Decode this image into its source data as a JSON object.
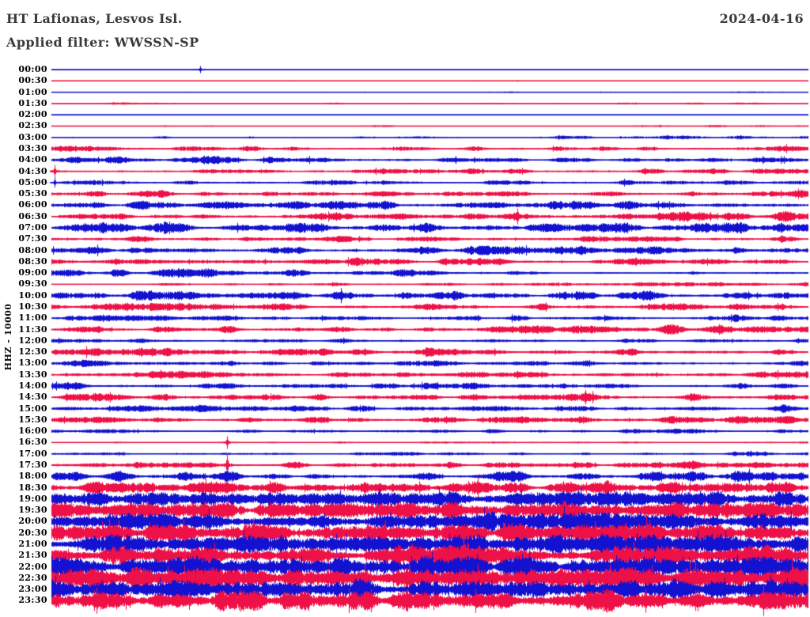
{
  "header": {
    "station": "HT Lafionas, Lesvos Isl.",
    "filter": "Applied filter: WWSSN-SP",
    "date": "2024-04-16"
  },
  "chart_data": {
    "type": "line",
    "subtype": "helicorder_day_plot",
    "title": "HT Lafionas, Lesvos Isl.",
    "date": "2024-04-16",
    "applied_filter": "WWSSN-SP",
    "y_axis_label": "HHZ - 10000",
    "channel": "HHZ",
    "scale": 10000,
    "row_interval_minutes": 30,
    "n_rows": 48,
    "grid": false,
    "legend_position": "none",
    "colors": {
      "blue": "#1212d0",
      "red": "#ee1147"
    },
    "rows": [
      {
        "time": "00:00",
        "color": "blue",
        "env": [
          0.5,
          0.5,
          0.5,
          0.6,
          0.5,
          0.6,
          0.5,
          0.5,
          0.6,
          0.5,
          0.5,
          0.5
        ],
        "spikes": [
          [
            0.196,
            4.5
          ]
        ]
      },
      {
        "time": "00:30",
        "color": "red",
        "env": [
          0.5,
          0.5,
          0.5,
          0.5,
          0.5,
          0.6,
          0.5,
          0.5,
          0.5,
          0.6,
          0.5,
          0.5
        ]
      },
      {
        "time": "01:00",
        "color": "blue",
        "env": [
          0.5,
          0.5,
          0.5,
          0.5,
          0.5,
          0.5,
          0.7,
          0.9,
          0.6,
          0.5,
          0.9,
          0.6
        ]
      },
      {
        "time": "01:30",
        "color": "red",
        "env": [
          0.6,
          1.3,
          0.7,
          0.6,
          1.1,
          0.7,
          1.3,
          1.1,
          1.3,
          0.9,
          1.5,
          1.1
        ]
      },
      {
        "time": "02:00",
        "color": "blue",
        "env": [
          0.5,
          0.5,
          0.5,
          0.5,
          0.5,
          0.5,
          0.5,
          0.5,
          0.8,
          0.5,
          0.5,
          0.5
        ]
      },
      {
        "time": "02:30",
        "color": "red",
        "env": [
          0.6,
          0.8,
          1.1,
          0.6,
          0.6,
          1.2,
          0.7,
          1.3,
          0.8,
          1.4,
          1.1,
          1.3
        ]
      },
      {
        "time": "03:00",
        "color": "blue",
        "env": [
          1.1,
          1.4,
          1.6,
          1.1,
          1.4,
          1.2,
          1.4,
          1.8,
          2.0,
          2.3,
          2.3,
          2.6
        ]
      },
      {
        "time": "03:30",
        "color": "red",
        "env": [
          4.5,
          3.6,
          3.2,
          3.0,
          3.4,
          3.8,
          3.4,
          3.0,
          3.5,
          3.9,
          3.8,
          4.2
        ]
      },
      {
        "time": "04:00",
        "color": "blue",
        "env": [
          4.0,
          4.4,
          4.8,
          3.8,
          3.4,
          3.8,
          3.4,
          3.0,
          3.4,
          3.8,
          3.4,
          3.8
        ]
      },
      {
        "time": "04:30",
        "color": "red",
        "env": [
          3.4,
          3.0,
          3.4,
          2.9,
          3.0,
          3.4,
          3.0,
          3.4,
          3.0,
          3.4,
          3.8,
          3.4
        ],
        "spikes": [
          [
            0.004,
            8
          ]
        ]
      },
      {
        "time": "05:00",
        "color": "blue",
        "env": [
          3.0,
          3.4,
          3.0,
          2.6,
          3.0,
          3.4,
          3.0,
          3.0,
          3.4,
          3.0,
          3.4,
          3.0
        ],
        "spikes": [
          [
            0.004,
            6
          ]
        ]
      },
      {
        "time": "05:30",
        "color": "red",
        "env": [
          3.8,
          4.2,
          3.8,
          3.4,
          3.8,
          4.2,
          3.8,
          3.8,
          4.2,
          4.6,
          4.2,
          4.6
        ]
      },
      {
        "time": "06:00",
        "color": "blue",
        "env": [
          4.8,
          5.2,
          4.8,
          4.4,
          4.8,
          5.2,
          4.8,
          4.8,
          5.2,
          4.8,
          5.2,
          4.8
        ]
      },
      {
        "time": "06:30",
        "color": "red",
        "env": [
          5.0,
          5.8,
          5.4,
          5.0,
          5.4,
          5.8,
          5.4,
          5.0,
          5.4,
          5.8,
          5.4,
          5.8
        ]
      },
      {
        "time": "07:00",
        "color": "blue",
        "env": [
          5.8,
          6.2,
          5.8,
          5.4,
          5.8,
          6.2,
          5.8,
          5.8,
          6.2,
          5.8,
          6.2,
          5.8
        ]
      },
      {
        "time": "07:30",
        "color": "red",
        "env": [
          3.4,
          3.8,
          3.4,
          3.0,
          3.4,
          3.8,
          3.4,
          3.4,
          3.8,
          3.4,
          3.8,
          3.8
        ]
      },
      {
        "time": "08:00",
        "color": "blue",
        "env": [
          5.0,
          5.4,
          5.8,
          5.0,
          5.4,
          5.8,
          5.4,
          5.0,
          5.4,
          5.8,
          5.4,
          5.0
        ]
      },
      {
        "time": "08:30",
        "color": "red",
        "env": [
          4.0,
          4.4,
          4.0,
          4.4,
          4.8,
          4.4,
          4.0,
          4.4,
          4.8,
          4.4,
          4.8,
          4.4
        ]
      },
      {
        "time": "09:00",
        "color": "blue",
        "env": [
          6.0,
          5.2,
          4.8,
          4.4,
          4.8,
          5.2,
          4.8,
          1.8,
          1.0,
          1.4,
          2.4,
          1.4
        ]
      },
      {
        "time": "09:30",
        "color": "red",
        "env": [
          0.8,
          1.0,
          1.5,
          1.2,
          1.8,
          2.0,
          2.2,
          2.4,
          2.5,
          2.7,
          2.5,
          2.2
        ]
      },
      {
        "time": "10:00",
        "color": "blue",
        "env": [
          5.4,
          5.8,
          5.4,
          5.0,
          5.4,
          5.8,
          5.4,
          5.4,
          5.8,
          5.4,
          5.8,
          5.4
        ]
      },
      {
        "time": "10:30",
        "color": "red",
        "env": [
          4.4,
          4.8,
          4.4,
          4.0,
          4.4,
          4.8,
          4.4,
          4.4,
          4.8,
          5.4,
          4.8,
          4.4
        ]
      },
      {
        "time": "11:00",
        "color": "blue",
        "env": [
          3.4,
          3.8,
          3.4,
          3.0,
          4.4,
          3.4,
          3.0,
          3.4,
          3.0,
          3.4,
          3.8,
          3.4
        ]
      },
      {
        "time": "11:30",
        "color": "red",
        "env": [
          3.8,
          4.2,
          3.8,
          3.4,
          3.8,
          4.2,
          3.8,
          4.8,
          5.2,
          5.8,
          5.2,
          5.6
        ]
      },
      {
        "time": "12:00",
        "color": "blue",
        "env": [
          2.4,
          2.8,
          3.2,
          2.4,
          2.8,
          2.4,
          2.8,
          2.4,
          2.8,
          2.4,
          2.8,
          2.4
        ]
      },
      {
        "time": "12:30",
        "color": "red",
        "env": [
          4.4,
          4.8,
          4.4,
          4.0,
          4.4,
          4.8,
          4.4,
          4.4,
          4.8,
          4.4,
          4.8,
          4.4
        ]
      },
      {
        "time": "13:00",
        "color": "blue",
        "env": [
          3.4,
          3.8,
          3.4,
          3.0,
          3.4,
          3.8,
          3.4,
          3.4,
          3.8,
          3.4,
          3.8,
          3.4
        ]
      },
      {
        "time": "13:30",
        "color": "red",
        "env": [
          4.4,
          4.8,
          4.4,
          4.0,
          4.4,
          4.8,
          4.4,
          4.4,
          4.8,
          4.4,
          4.8,
          4.8
        ]
      },
      {
        "time": "14:00",
        "color": "blue",
        "env": [
          3.8,
          4.2,
          3.8,
          3.4,
          3.8,
          4.2,
          3.8,
          3.8,
          4.2,
          3.8,
          4.2,
          3.8
        ]
      },
      {
        "time": "14:30",
        "color": "red",
        "env": [
          4.4,
          4.8,
          4.4,
          4.0,
          4.4,
          4.8,
          4.4,
          4.4,
          4.8,
          4.4,
          4.8,
          4.4
        ]
      },
      {
        "time": "15:00",
        "color": "blue",
        "env": [
          3.8,
          4.2,
          3.8,
          3.4,
          3.8,
          4.2,
          3.8,
          3.8,
          4.2,
          3.8,
          4.2,
          3.8
        ]
      },
      {
        "time": "15:30",
        "color": "red",
        "env": [
          4.4,
          4.0,
          4.4,
          4.8,
          4.4,
          4.0,
          4.4,
          4.8,
          4.4,
          4.8,
          4.4,
          4.8
        ]
      },
      {
        "time": "16:00",
        "color": "blue",
        "env": [
          2.0,
          2.4,
          2.0,
          2.8,
          2.4,
          2.0,
          2.4,
          2.0,
          2.4,
          2.8,
          2.4,
          2.0
        ]
      },
      {
        "time": "16:30",
        "color": "red",
        "env": [
          1.0,
          1.1,
          1.0,
          1.0,
          1.1,
          1.0,
          1.1,
          1.0,
          1.1,
          1.0,
          1.1,
          1.0
        ],
        "spikes": [
          [
            0.232,
            8
          ]
        ]
      },
      {
        "time": "17:00",
        "color": "blue",
        "env": [
          2.0,
          2.4,
          2.0,
          2.4,
          2.0,
          2.4,
          2.0,
          2.4,
          2.0,
          2.4,
          2.8,
          2.4
        ]
      },
      {
        "time": "17:30",
        "color": "red",
        "env": [
          3.0,
          3.4,
          3.8,
          3.4,
          3.8,
          4.2,
          3.8,
          4.2,
          4.8,
          4.4,
          4.8,
          4.8
        ],
        "spikes": [
          [
            0.232,
            15
          ]
        ]
      },
      {
        "time": "18:00",
        "color": "blue",
        "env": [
          5.8,
          6.2,
          5.8,
          5.4,
          5.8,
          6.2,
          5.8,
          5.8,
          6.2,
          5.8,
          6.2,
          5.8
        ]
      },
      {
        "time": "18:30",
        "color": "red",
        "env": [
          6.8,
          7.2,
          6.8,
          6.4,
          6.8,
          7.2,
          6.8,
          6.8,
          7.2,
          6.8,
          7.2,
          6.8
        ]
      },
      {
        "time": "19:00",
        "color": "blue",
        "env": [
          7.8,
          8.2,
          7.8,
          7.4,
          7.8,
          8.2,
          7.8,
          7.8,
          8.2,
          7.8,
          8.2,
          7.8
        ]
      },
      {
        "time": "19:30",
        "color": "red",
        "env": [
          8.8,
          9.2,
          8.8,
          8.4,
          8.8,
          9.2,
          8.8,
          8.8,
          9.2,
          8.8,
          9.2,
          8.8
        ]
      },
      {
        "time": "20:00",
        "color": "blue",
        "env": [
          9.6,
          10,
          9.6,
          9.2,
          9.6,
          10,
          9.6,
          9.6,
          10,
          9.6,
          10,
          9.6
        ]
      },
      {
        "time": "20:30",
        "color": "red",
        "env": [
          9.8,
          10.4,
          10,
          9.6,
          10,
          10.4,
          10,
          9.6,
          10,
          10.4,
          10,
          9.6
        ]
      },
      {
        "time": "21:00",
        "color": "blue",
        "env": [
          10.6,
          11,
          10.6,
          10.2,
          10.6,
          11,
          10.6,
          10.6,
          11,
          10.6,
          11,
          10.6
        ]
      },
      {
        "time": "21:30",
        "color": "red",
        "env": [
          10.6,
          11,
          10.6,
          10.2,
          10.6,
          11,
          10.6,
          10.6,
          11,
          10.6,
          11,
          10.6
        ]
      },
      {
        "time": "22:00",
        "color": "blue",
        "env": [
          11.4,
          11.8,
          11.4,
          11,
          11.4,
          11.8,
          11.4,
          11.4,
          11.8,
          11.4,
          11.8,
          11.4
        ]
      },
      {
        "time": "22:30",
        "color": "red",
        "env": [
          11,
          11.4,
          11,
          10.6,
          11,
          11.4,
          11,
          11,
          11.4,
          11,
          11.4,
          11
        ]
      },
      {
        "time": "23:00",
        "color": "blue",
        "env": [
          11,
          11.4,
          11,
          10.6,
          11,
          11.4,
          11,
          11,
          11.4,
          11,
          11.4,
          11.4
        ]
      },
      {
        "time": "23:30",
        "color": "red",
        "env": [
          11.4,
          11.8,
          11.4,
          11,
          11.4,
          11.8,
          11.4,
          11.4,
          11.8,
          11.4,
          11.8,
          12.4
        ]
      }
    ]
  }
}
